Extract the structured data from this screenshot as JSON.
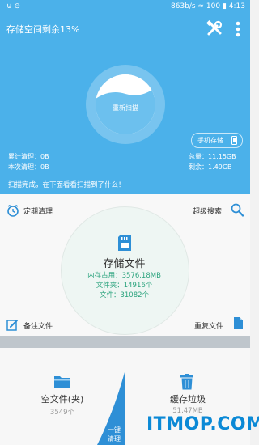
{
  "status_bar": {
    "speed": "863b/s",
    "battery": "100",
    "time": "4:13"
  },
  "header": {
    "title": "存储空间剩余13%",
    "tools_icon": "tools-icon",
    "more_icon": "more-vertical-icon"
  },
  "gauge": {
    "button_label": "重新扫描",
    "used_fraction": 0.87
  },
  "storage_switch": {
    "label": "手机存储"
  },
  "stats": {
    "cumulative_label": "累计清理：",
    "cumulative_value": "0B",
    "this_time_label": "本次清理：",
    "this_time_value": "0B",
    "total_label": "总量：",
    "total_value": "11.15GB",
    "remain_label": "剩余：",
    "remain_value": "1.49GB"
  },
  "scan_message": "扫描完成，在下面看看扫描到了什么！",
  "features": {
    "scheduled_clean": "定期清理",
    "super_search": "超级搜索",
    "note_files": "备注文件",
    "duplicate_files": "重复文件"
  },
  "center": {
    "title": "存储文件",
    "mem_label": "内存占用：",
    "mem_value": "3576.18MB",
    "folders_label": "文件夹：",
    "folders_value": "14916个",
    "files_label": "文件：",
    "files_value": "31082个"
  },
  "bottom": {
    "empty_folders_title": "空文件(夹)",
    "empty_folders_count": "3549个",
    "cache_title": "缓存垃圾",
    "cache_size": "51.47MB",
    "one_click_line1": "一键",
    "one_click_line2": "清理"
  },
  "watermark": "ITMOP.COM",
  "colors": {
    "header_bg": "#4bb1ea",
    "accent_blue": "#2e8fd6",
    "accent_green": "#2aa37d"
  }
}
